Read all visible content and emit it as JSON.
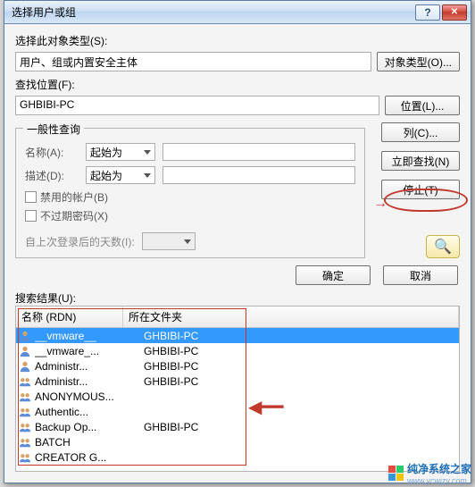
{
  "titlebar": {
    "title": "选择用户或组"
  },
  "object_type": {
    "label": "选择此对象类型(S):",
    "value": "用户、组或内置安全主体",
    "button": "对象类型(O)..."
  },
  "location": {
    "label": "查找位置(F):",
    "value": "GHBIBI-PC",
    "button": "位置(L)..."
  },
  "common_queries": {
    "legend": "一般性查询",
    "name_label": "名称(A):",
    "name_combo": "起始为",
    "desc_label": "描述(D):",
    "desc_combo": "起始为",
    "chk_disabled": "禁用的帐户(B)",
    "chk_nonexpire": "不过期密码(X)",
    "days_label": "自上次登录后的天数(I):"
  },
  "side_buttons": {
    "columns": "列(C)...",
    "find_now": "立即查找(N)",
    "stop": "停止(T)"
  },
  "bottom": {
    "ok": "确定",
    "cancel": "取消"
  },
  "results": {
    "label": "搜索结果(U):",
    "col1": "名称 (RDN)",
    "col2": "所在文件夹",
    "rows": [
      {
        "icon": "user",
        "name": "__vmware__",
        "folder": "GHBIBI-PC",
        "selected": true
      },
      {
        "icon": "user",
        "name": "__vmware_...",
        "folder": "GHBIBI-PC"
      },
      {
        "icon": "user",
        "name": "Administr...",
        "folder": "GHBIBI-PC"
      },
      {
        "icon": "group",
        "name": "Administr...",
        "folder": "GHBIBI-PC"
      },
      {
        "icon": "group",
        "name": "ANONYMOUS...",
        "folder": ""
      },
      {
        "icon": "group",
        "name": "Authentic...",
        "folder": ""
      },
      {
        "icon": "group",
        "name": "Backup Op...",
        "folder": "GHBIBI-PC"
      },
      {
        "icon": "group",
        "name": "BATCH",
        "folder": ""
      },
      {
        "icon": "group",
        "name": "CREATOR G...",
        "folder": ""
      }
    ]
  },
  "watermark": {
    "text": "纯净系统之家",
    "url": "www.ycwjzy.com"
  }
}
